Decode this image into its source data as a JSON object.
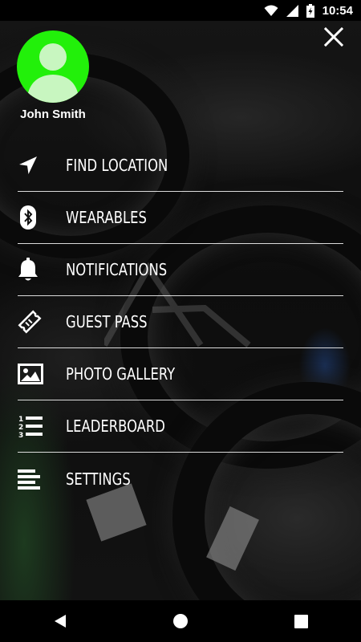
{
  "status_bar": {
    "time": "10:54",
    "icons": [
      "wifi-icon",
      "cell-signal-icon",
      "battery-charging-icon"
    ]
  },
  "profile": {
    "name": "John Smith",
    "avatar_color": "#22f00a"
  },
  "menu": {
    "items": [
      {
        "label": "FIND LOCATION",
        "icon": "navigation-arrow-icon"
      },
      {
        "label": "WEARABLES",
        "icon": "bluetooth-icon"
      },
      {
        "label": "NOTIFICATIONS",
        "icon": "bell-icon"
      },
      {
        "label": "GUEST PASS",
        "icon": "ticket-icon"
      },
      {
        "label": "PHOTO GALLERY",
        "icon": "image-icon"
      },
      {
        "label": "LEADERBOARD",
        "icon": "ranked-list-icon"
      },
      {
        "label": "SETTINGS",
        "icon": "settings-lines-icon"
      }
    ]
  },
  "nav_bar": {
    "buttons": [
      "back-icon",
      "home-icon",
      "recents-icon"
    ]
  }
}
